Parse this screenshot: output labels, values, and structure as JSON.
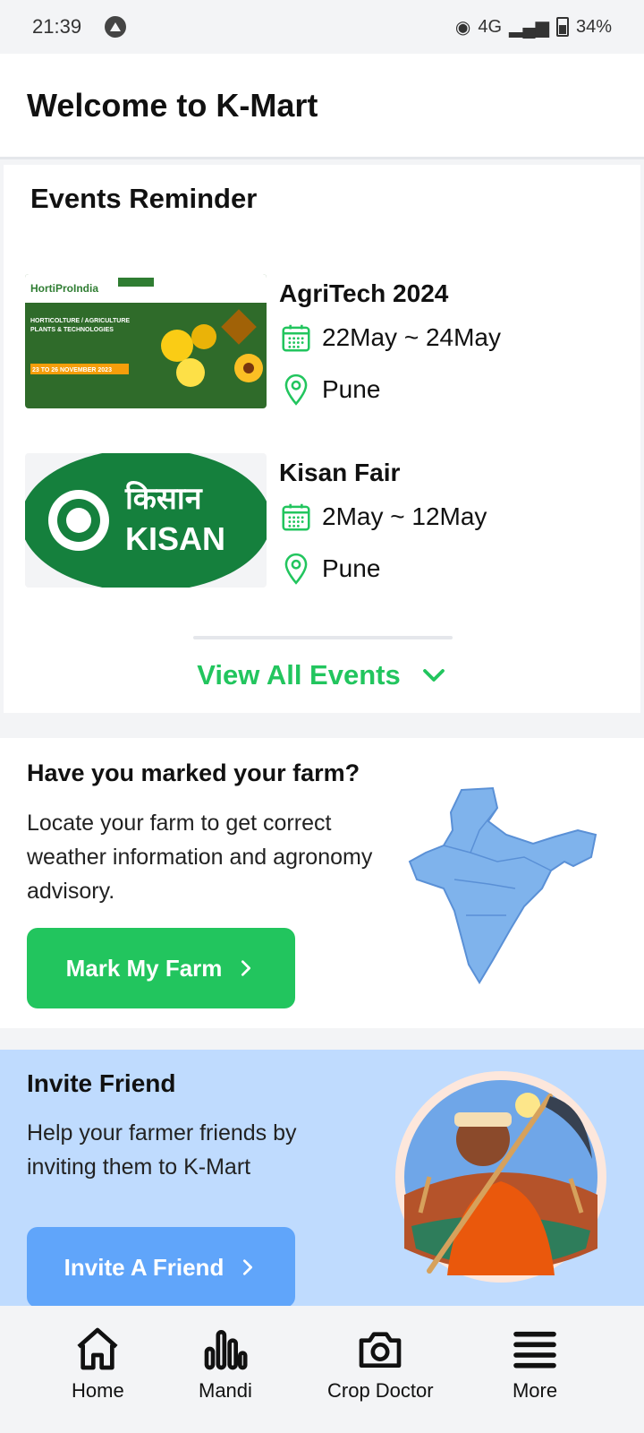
{
  "status": {
    "time": "21:39",
    "network": "4G",
    "battery": "34%"
  },
  "header": {
    "title": "Welcome to K-Mart"
  },
  "events": {
    "title": "Events Reminder",
    "items": [
      {
        "name": "AgriTech 2024",
        "dates": "22May ~ 24May",
        "location": "Pune",
        "thumb_text": "HORTICOLTURE / AGRICULTURE PLANTS & TECHNOLOGIES",
        "thumb_date": "23 TO 26 NOVEMBER 2023",
        "thumb_brand": "HortiProIndia"
      },
      {
        "name": "Kisan Fair",
        "dates": "2May ~ 12May",
        "location": "Pune",
        "thumb_hindi": "किसान",
        "thumb_brand": "KISAN"
      }
    ],
    "view_all": "View All Events"
  },
  "farm": {
    "title": "Have you marked your farm?",
    "description": "Locate your farm to get correct weather information and agronomy advisory.",
    "button": "Mark My Farm"
  },
  "invite": {
    "title": "Invite Friend",
    "description": "Help your farmer friends by inviting them to K-Mart",
    "button": "Invite A Friend"
  },
  "nav": {
    "home": "Home",
    "mandi": "Mandi",
    "crop_doctor": "Crop Doctor",
    "more": "More"
  },
  "colors": {
    "accent": "#22c55e",
    "invite_bg": "#bfdbfe",
    "invite_button": "#60a5fa"
  }
}
